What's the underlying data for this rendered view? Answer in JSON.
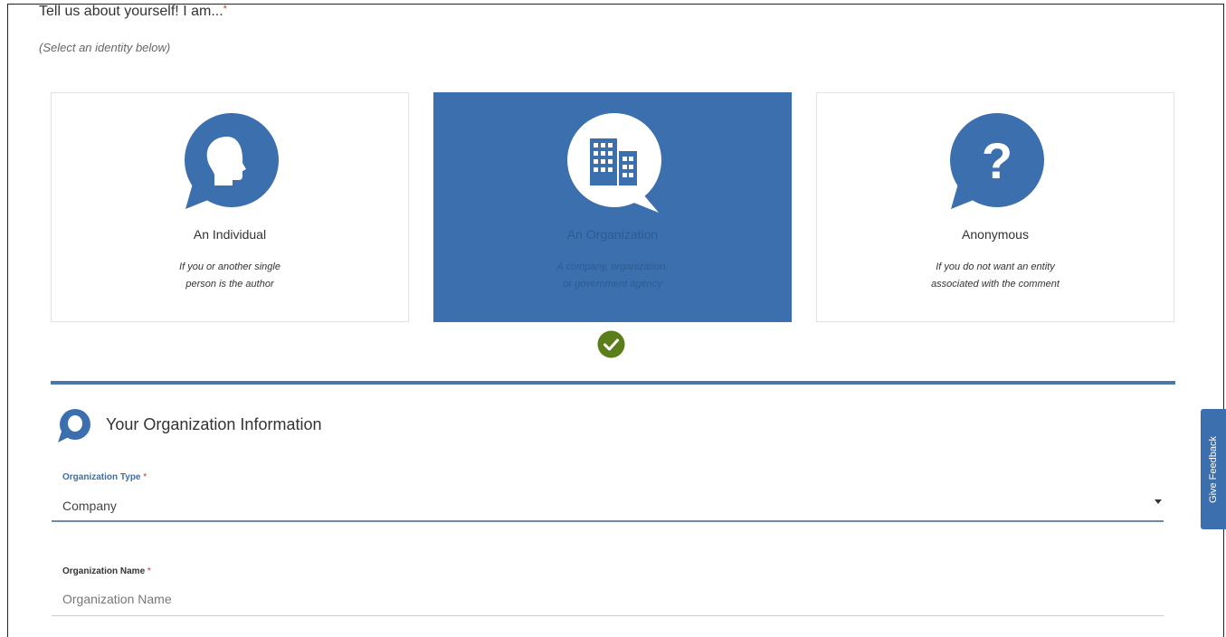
{
  "prompt": {
    "title": "Tell us about yourself! I am...",
    "required_mark": "*",
    "hint": "(Select an identity below)"
  },
  "identity_cards": [
    {
      "label": "An Individual",
      "desc_line1": "If you or another single",
      "desc_line2": "person is the author",
      "icon": "person-head-icon",
      "selected": false
    },
    {
      "label": "An Organization",
      "desc_line1": "A company, organization,",
      "desc_line2": "or government agency",
      "icon": "building-icon",
      "selected": true
    },
    {
      "label": "Anonymous",
      "desc_line1": "If you do not want an entity",
      "desc_line2": "associated with the comment",
      "icon": "question-mark-icon",
      "selected": false
    }
  ],
  "colors": {
    "accent": "#3b6fad",
    "check_green": "#5a7f1a",
    "divider": "#4a76a8"
  },
  "section": {
    "title": "Your Organization Information",
    "icon": "speech-bubble-icon"
  },
  "form": {
    "org_type_label": "Organization Type",
    "org_type_required": "*",
    "org_type_value": "Company",
    "org_name_label": "Organization Name",
    "org_name_required": "*",
    "org_name_placeholder": "Organization Name"
  },
  "feedback_tab": {
    "label": "Give Feedback"
  }
}
